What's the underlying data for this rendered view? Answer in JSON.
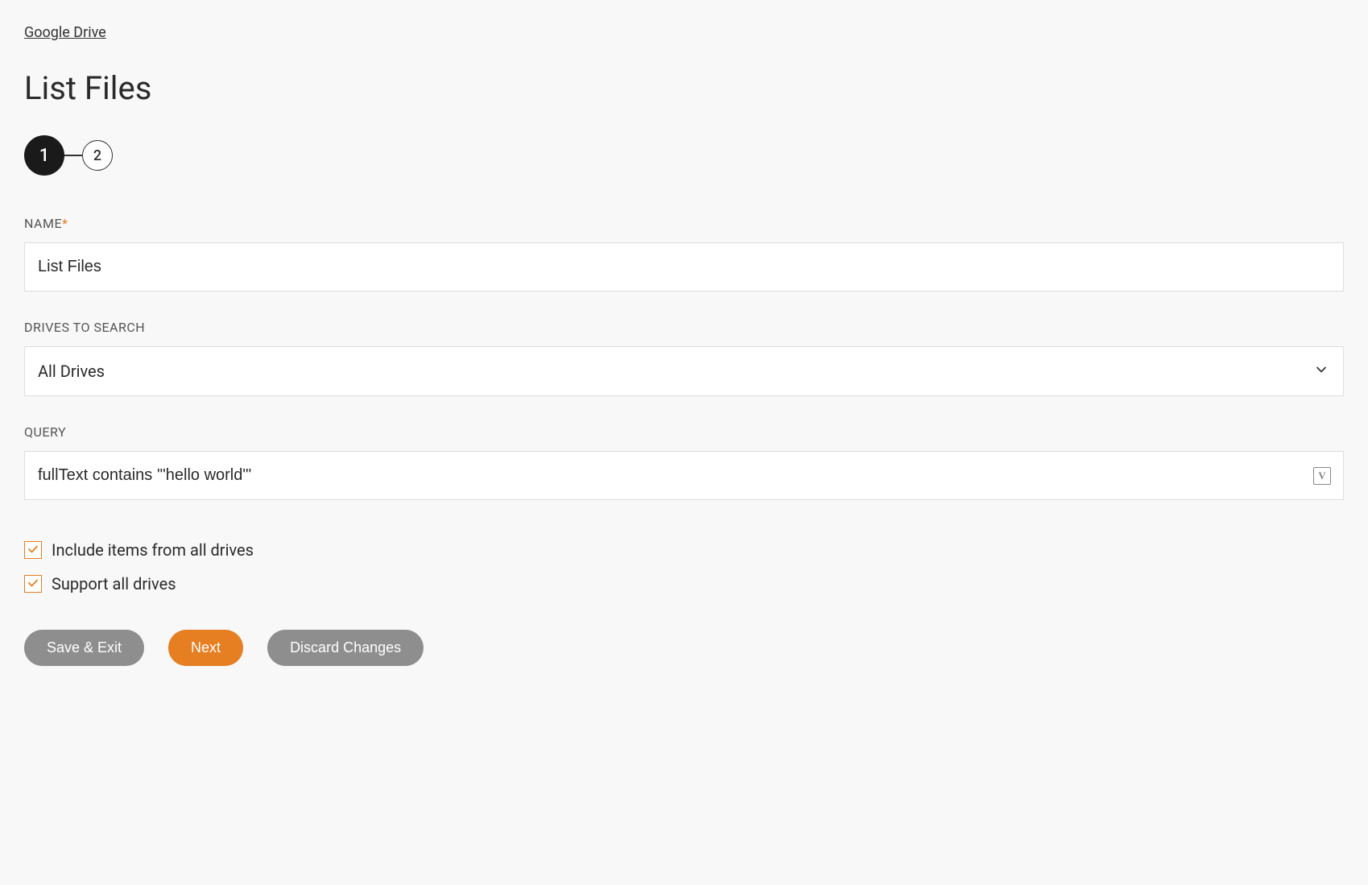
{
  "breadcrumb": {
    "label": "Google Drive"
  },
  "page": {
    "title": "List Files"
  },
  "steps": {
    "active": "1",
    "inactive": "2"
  },
  "form": {
    "name": {
      "label": "NAME",
      "required_marker": "*",
      "value": "List Files"
    },
    "drives": {
      "label": "DRIVES TO SEARCH",
      "selected": "All Drives"
    },
    "query": {
      "label": "QUERY",
      "value": "fullText contains '\"hello world\"'",
      "variable_icon_label": "V"
    },
    "checkboxes": {
      "include_all": {
        "label": "Include items from all drives",
        "checked": true
      },
      "support_all": {
        "label": "Support all drives",
        "checked": true
      }
    }
  },
  "buttons": {
    "save_exit": "Save & Exit",
    "next": "Next",
    "discard": "Discard Changes"
  }
}
